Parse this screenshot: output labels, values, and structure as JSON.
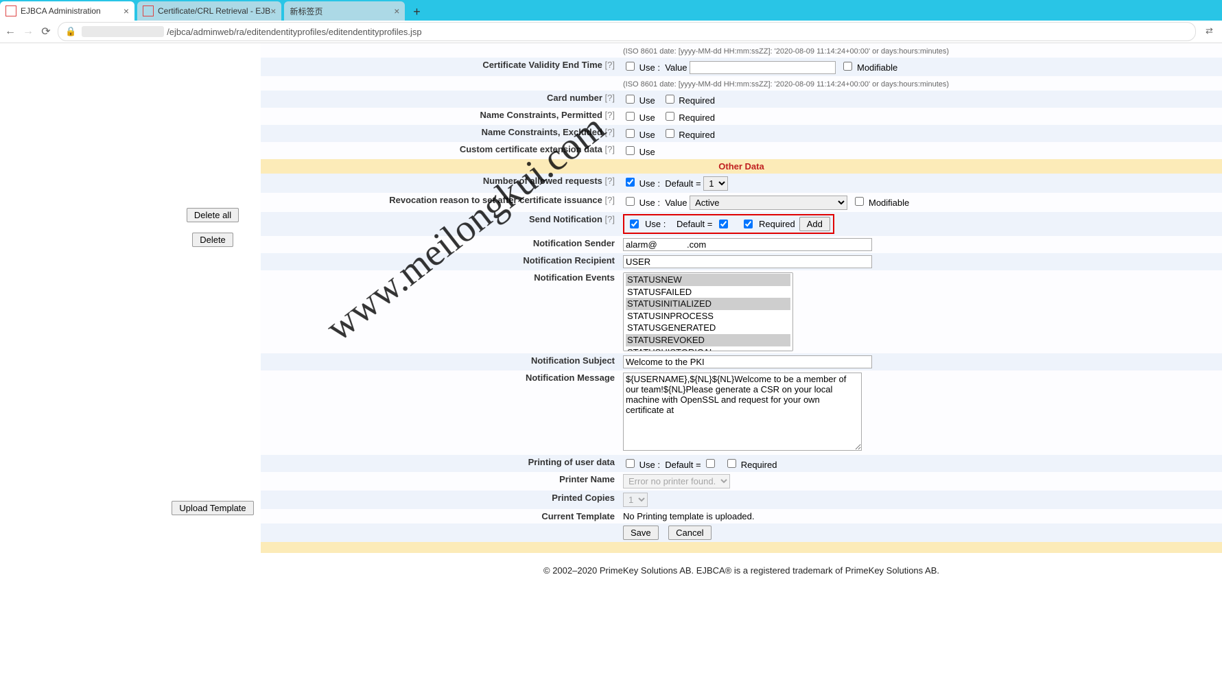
{
  "browser": {
    "tabs": [
      {
        "title": "EJBCA Administration",
        "active": true
      },
      {
        "title": "Certificate/CRL Retrieval - EJB",
        "active": false
      },
      {
        "title": "新标签页",
        "active": false
      }
    ],
    "new_tab_glyph": "+",
    "close_glyph": "×",
    "nav_back": "←",
    "nav_fwd": "→",
    "nav_reload": "⟳",
    "lock_glyph": "🔒",
    "url_path": "/ejbca/adminweb/ra/editendentityprofiles/editendentityprofiles.jsp",
    "translate_glyph": "⇄"
  },
  "sidebar_buttons": {
    "delete_all": "Delete all",
    "delete": "Delete",
    "upload_template": "Upload Template"
  },
  "labels": {
    "cert_validity_end": "Certificate Validity End Time",
    "card_number": "Card number",
    "name_perm": "Name Constraints, Permitted",
    "name_excl": "Name Constraints, Excluded",
    "custom_ext": "Custom certificate extension data",
    "other_data": "Other Data",
    "num_allowed": "Number of allowed requests",
    "revocation": "Revocation reason to set after certificate issuance",
    "send_notif": "Send Notification",
    "notif_sender": "Notification Sender",
    "notif_recipient": "Notification Recipient",
    "notif_events": "Notification Events",
    "notif_subject": "Notification Subject",
    "notif_message": "Notification Message",
    "printing": "Printing of user data",
    "printer_name": "Printer Name",
    "printed_copies": "Printed Copies",
    "current_template": "Current Template",
    "help": "[?]"
  },
  "controls": {
    "use": "Use",
    "use_colon": "Use :",
    "required": "Required",
    "modifiable": "Modifiable",
    "value": "Value",
    "default_eq": "Default =",
    "add": "Add",
    "save": "Save",
    "cancel": "Cancel"
  },
  "hints": {
    "iso8601": "(ISO 8601 date: [yyyy-MM-dd HH:mm:ssZZ]: '2020-08-09 11:14:24+00:00' or days:hours:minutes)"
  },
  "values": {
    "num_allowed_default": "1",
    "revocation_value": "Active",
    "notif_sender": "alarm@            .com",
    "notif_recipient": "USER",
    "events": [
      "STATUSNEW",
      "STATUSFAILED",
      "STATUSINITIALIZED",
      "STATUSINPROCESS",
      "STATUSGENERATED",
      "STATUSREVOKED",
      "STATUSHISTORICAL"
    ],
    "events_selected": [
      "STATUSNEW",
      "STATUSINITIALIZED",
      "STATUSREVOKED"
    ],
    "notif_subject": "Welcome to the PKI",
    "notif_message": "${USERNAME},${NL}${NL}Welcome to be a member of our team!${NL}Please generate a CSR on your local machine with OpenSSL and request for your own certificate at",
    "printer_name": "Error no printer found.",
    "printed_copies": "1",
    "current_template_status": "No Printing template is uploaded."
  },
  "footer": "© 2002–2020 PrimeKey Solutions AB. EJBCA® is a registered trademark of PrimeKey Solutions AB.",
  "watermark": "www.meilongkui.com"
}
